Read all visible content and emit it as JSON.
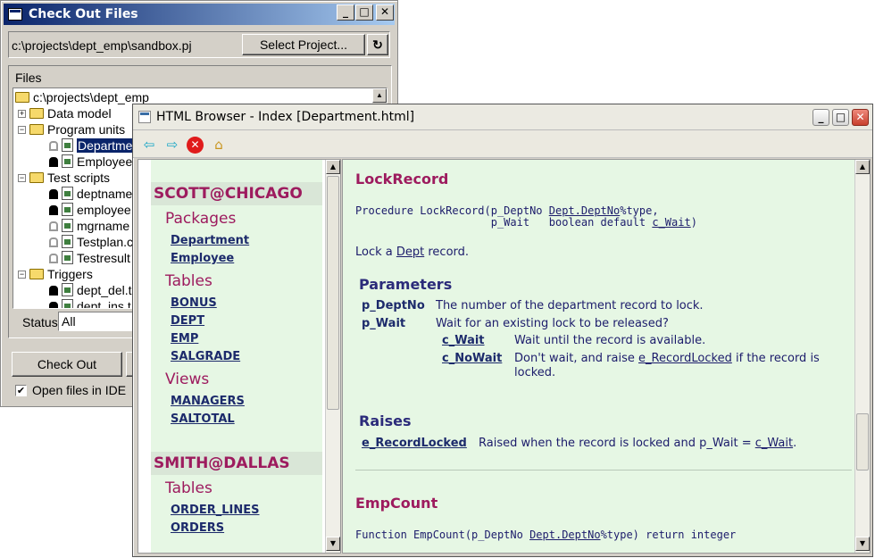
{
  "checkout": {
    "title": "Check Out Files",
    "project_path": "c:\\projects\\dept_emp\\sandbox.pj",
    "select_project_label": "Select Project...",
    "files_label": "Files",
    "tree": [
      {
        "label": "c:\\projects\\dept_emp"
      },
      {
        "label": "Data model"
      },
      {
        "label": "Program units"
      },
      {
        "label": "Departme"
      },
      {
        "label": "Employee"
      },
      {
        "label": "Test scripts"
      },
      {
        "label": "deptname"
      },
      {
        "label": "employee"
      },
      {
        "label": "mgrname"
      },
      {
        "label": "Testplan.c"
      },
      {
        "label": "Testresult"
      },
      {
        "label": "Triggers"
      },
      {
        "label": "dept_del.t"
      },
      {
        "label": "dept_ins.t"
      }
    ],
    "status_label": "Status",
    "status_value": "All",
    "checkout_label": "Check Out",
    "open_files_label": "Open files in IDE",
    "open_files_checked": true
  },
  "browser": {
    "title": "HTML Browser - Index [Department.html]",
    "left": {
      "db1": "SCOTT@CHICAGO",
      "packages_heading": "Packages",
      "packages": [
        "Department",
        "Employee"
      ],
      "tables_heading": "Tables",
      "tables": [
        "BONUS",
        "DEPT",
        "EMP",
        "SALGRADE"
      ],
      "views_heading": "Views",
      "views": [
        "MANAGERS",
        "SALTOTAL"
      ],
      "db2": "SMITH@DALLAS",
      "tables2_heading": "Tables",
      "tables2": [
        "ORDER_LINES",
        "ORDERS"
      ]
    },
    "lockrecord": {
      "heading": "LockRecord",
      "sig_line1_a": "Procedure LockRecord(p_DeptNo ",
      "sig_line1_link": "Dept.DeptNo",
      "sig_line1_b": "%type,",
      "sig_line2_a": "                     p_Wait   boolean default ",
      "sig_line2_link": "c_Wait",
      "sig_line2_b": ")",
      "desc_a": "Lock a ",
      "desc_link": "Dept",
      "desc_b": " record.",
      "params_heading": "Parameters",
      "p1_name": "p_DeptNo",
      "p1_desc": "The number of the department record to lock.",
      "p2_name": "p_Wait",
      "p2_desc": "Wait for an existing lock to be released?",
      "c1_name": "c_Wait",
      "c1_desc": "Wait until the record is available.",
      "c2_name": "c_NoWait",
      "c2_desc_a": "Don't wait, and raise ",
      "c2_desc_link": "e_RecordLocked",
      "c2_desc_b": " if the record is",
      "c2_desc_line2": "locked.",
      "raises_heading": "Raises",
      "r1_name": "e_RecordLocked",
      "r1_desc_a": "Raised when the record is locked and p_Wait = ",
      "r1_desc_link": "c_Wait",
      "r1_desc_b": "."
    },
    "empcount": {
      "heading": "EmpCount",
      "sig_a": "Function EmpCount(p_DeptNo ",
      "sig_link": "Dept.DeptNo",
      "sig_b": "%type) return integer"
    }
  }
}
